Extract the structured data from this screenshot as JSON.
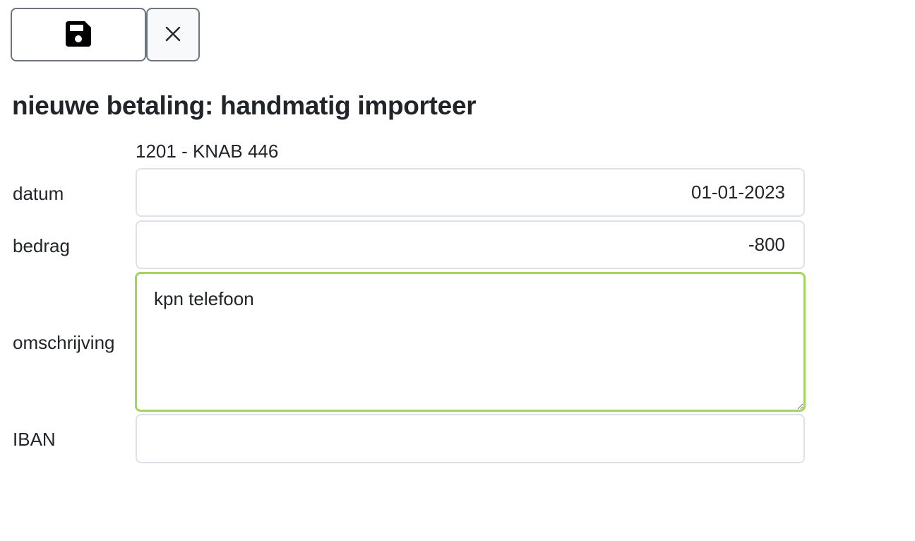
{
  "toolbar": {
    "save_icon": "floppy-disk-icon",
    "close_icon": "close-icon"
  },
  "page": {
    "title": "nieuwe betaling: handmatig importeer"
  },
  "form": {
    "account": "1201 - KNAB 446",
    "date": {
      "label": "datum",
      "value": "01-01-2023"
    },
    "amount": {
      "label": "bedrag",
      "value": "-800"
    },
    "description": {
      "label": "omschrijving",
      "value": "kpn telefoon"
    },
    "iban": {
      "label": "IBAN",
      "value": ""
    }
  },
  "colors": {
    "focus_border": "#a3d55f",
    "input_border": "#dee2e6",
    "button_border": "#6c757d"
  }
}
